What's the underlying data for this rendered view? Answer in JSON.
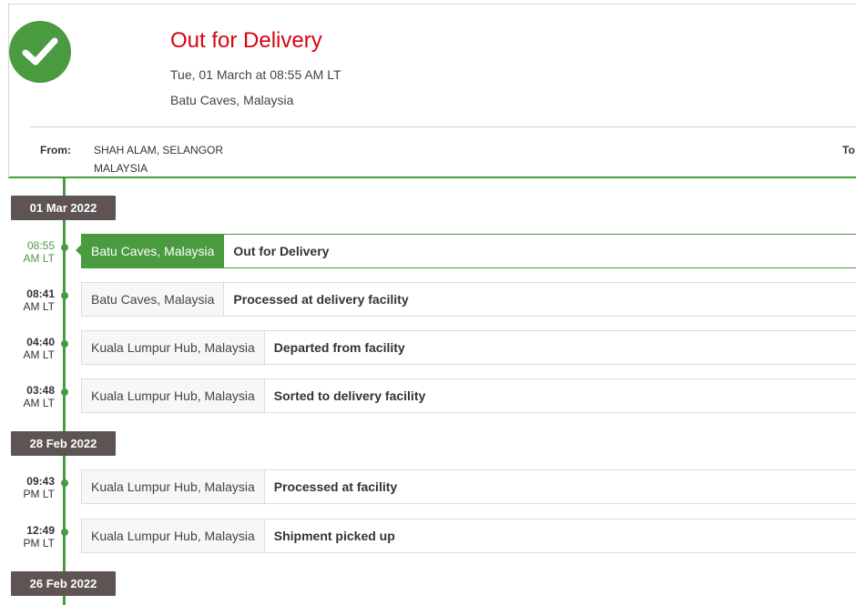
{
  "summary": {
    "status_title": "Out for Delivery",
    "status_datetime": "Tue, 01 March at 08:55 AM LT",
    "status_location": "Batu Caves, Malaysia",
    "check_icon": "check-icon",
    "from_label": "From:",
    "from_line1": "SHAH ALAM, SELANGOR",
    "from_line2": "MALAYSIA",
    "to_label": "To:"
  },
  "colors": {
    "accent_green": "#4a9b3f",
    "status_red": "#d40511",
    "date_chip_bg": "#5e5454"
  },
  "timeline": {
    "dates": [
      "01 Mar 2022",
      "28 Feb 2022",
      "26 Feb 2022"
    ],
    "events": [
      {
        "time": "08:55",
        "ampm": "AM LT",
        "location": "Batu Caves, Malaysia",
        "description": "Out for Delivery",
        "active": true
      },
      {
        "time": "08:41",
        "ampm": "AM LT",
        "location": "Batu Caves, Malaysia",
        "description": "Processed at delivery facility",
        "active": false
      },
      {
        "time": "04:40",
        "ampm": "AM LT",
        "location": "Kuala Lumpur Hub, Malaysia",
        "description": "Departed from facility",
        "active": false
      },
      {
        "time": "03:48",
        "ampm": "AM LT",
        "location": "Kuala Lumpur Hub, Malaysia",
        "description": "Sorted to delivery facility",
        "active": false
      },
      {
        "time": "09:43",
        "ampm": "PM LT",
        "location": "Kuala Lumpur Hub, Malaysia",
        "description": "Processed at facility",
        "active": false
      },
      {
        "time": "12:49",
        "ampm": "PM LT",
        "location": "Kuala Lumpur Hub, Malaysia",
        "description": "Shipment picked up",
        "active": false
      }
    ]
  }
}
